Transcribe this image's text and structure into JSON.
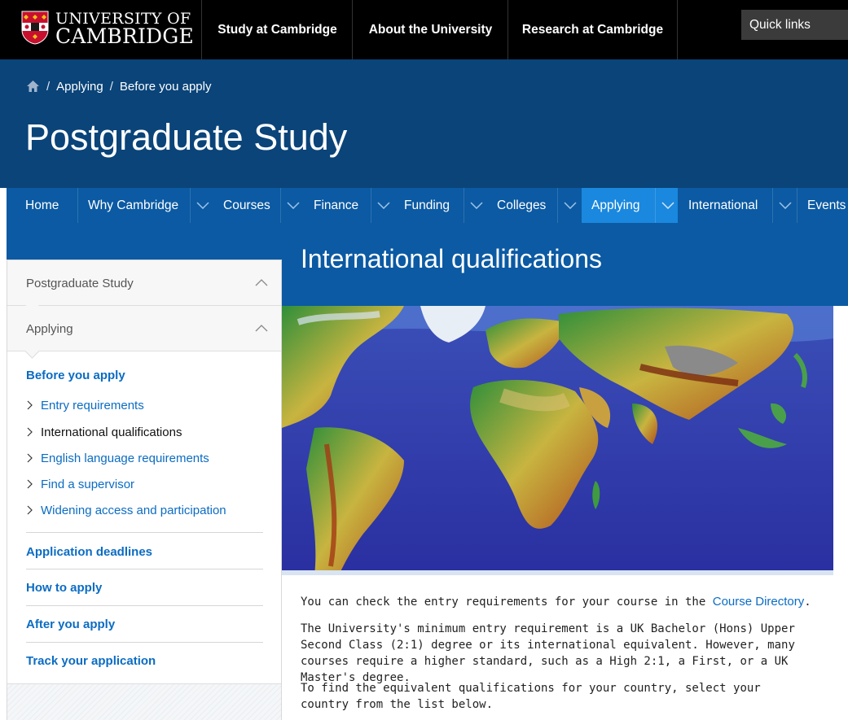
{
  "header": {
    "logo_line1": "UNIVERSITY OF",
    "logo_line2": "CAMBRIDGE",
    "nav": [
      "Study at Cambridge",
      "About the University",
      "Research at Cambridge"
    ],
    "quick_links": "Quick links"
  },
  "breadcrumb": {
    "home_icon": "home-icon",
    "items": [
      "Applying",
      "Before you apply"
    ],
    "separator": "/"
  },
  "site_title": "Postgraduate Study",
  "section_nav": {
    "items": [
      "Home",
      "Why Cambridge",
      "Courses",
      "Finance",
      "Funding",
      "Colleges",
      "Applying",
      "International",
      "Events"
    ],
    "active": "Applying"
  },
  "page_title": "International qualifications",
  "sidebar": {
    "level1": "Postgraduate Study",
    "level2": "Applying",
    "current_section": "Before you apply",
    "sub_items": [
      "Entry requirements",
      "International qualifications",
      "English language requirements",
      "Find a supervisor",
      "Widening access and participation"
    ],
    "current_sub_item": "International qualifications",
    "other_sections": [
      "Application deadlines",
      "How to apply",
      "After you apply",
      "Track your application"
    ]
  },
  "content": {
    "p1_before": "You can check the entry requirements for your course in the ",
    "p1_link": "Course Directory",
    "p1_after": ".",
    "p2": "The University's minimum entry requirement is a UK Bachelor (Hons) Upper Second Class (2:1) degree or its international equivalent. However, many courses require a higher standard, such as a High 2:1, a First, or a UK Master's degree.",
    "p3": "To find the equivalent qualifications for your country, select your country from the list below."
  },
  "colors": {
    "topbar": "#000000",
    "header_band": "#0a4479",
    "section_nav": "#0b5aa3",
    "active_tab": "#1a88de",
    "link": "#0b6cc3"
  }
}
